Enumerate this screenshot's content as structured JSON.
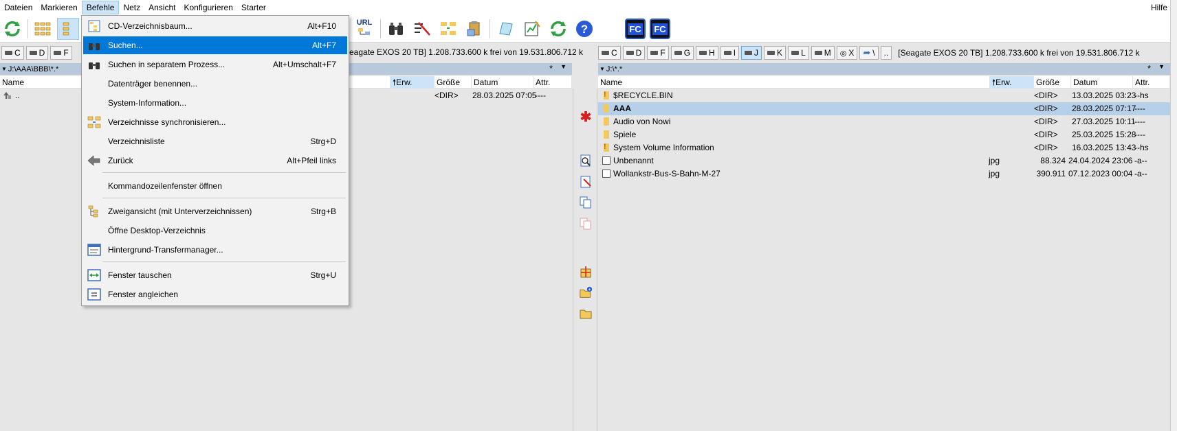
{
  "menubar": {
    "items": [
      "Dateien",
      "Markieren",
      "Befehle",
      "Netz",
      "Ansicht",
      "Konfigurieren",
      "Starter"
    ],
    "help": "Hilfe"
  },
  "toolbar": {
    "icons": [
      "refresh-icon",
      "brief-view-icon",
      "detailed-view-icon",
      "url-ftp-icon",
      "binoculars-icon",
      "multi-rename-icon",
      "sync-dirs-icon",
      "clipboard-icon",
      "notepad-icon",
      "compare-icon",
      "reload-icon",
      "help-icon",
      "fc-icon",
      "fc-icon"
    ],
    "url_label": "URL",
    "fc_label": "FC"
  },
  "left": {
    "drives": [
      "C",
      "D",
      "F"
    ],
    "drive_info_partial": "eagate EXOS 20 TB]  1.208.733.600 k frei von 19.531.806.712 k",
    "path": "J:\\AAA\\BBB\\*.*",
    "star": "*",
    "columns": {
      "name": "Name",
      "ext": "Erw.",
      "size": "Größe",
      "date": "Datum",
      "attr": "Attr."
    },
    "rows": [
      {
        "name": "..",
        "ext": "",
        "size": "<DIR>",
        "date": "28.03.2025 07:05",
        "attr": "----"
      }
    ]
  },
  "right": {
    "drives": [
      "C",
      "D",
      "F",
      "G",
      "H",
      "I",
      "J",
      "K",
      "L",
      "M",
      "X",
      "\\",
      ".."
    ],
    "selected_drive": "J",
    "drive_info": "[Seagate EXOS 20 TB]  1.208.733.600 k frei von 19.531.806.712 k",
    "path": "J:\\*.*",
    "star": "*",
    "columns": {
      "name": "Name",
      "ext": "Erw.",
      "size": "Größe",
      "date": "Datum",
      "attr": "Attr."
    },
    "rows": [
      {
        "name": "$RECYCLE.BIN",
        "ext": "",
        "size": "<DIR>",
        "date": "13.03.2025 03:23",
        "attr": "--hs",
        "type": "sysfolder"
      },
      {
        "name": "AAA",
        "ext": "",
        "size": "<DIR>",
        "date": "28.03.2025 07:17",
        "attr": "----",
        "type": "folder",
        "selected": true
      },
      {
        "name": "Audio von Nowi",
        "ext": "",
        "size": "<DIR>",
        "date": "27.03.2025 10:11",
        "attr": "----",
        "type": "folder"
      },
      {
        "name": "Spiele",
        "ext": "",
        "size": "<DIR>",
        "date": "25.03.2025 15:28",
        "attr": "----",
        "type": "folder"
      },
      {
        "name": "System Volume Information",
        "ext": "",
        "size": "<DIR>",
        "date": "16.03.2025 13:43",
        "attr": "--hs",
        "type": "sysfolder"
      },
      {
        "name": "Unbenannt",
        "ext": "jpg",
        "size": "88.324",
        "date": "24.04.2024 23:06",
        "attr": "-a--",
        "type": "img"
      },
      {
        "name": "Wollankstr-Bus-S-Bahn-M-27",
        "ext": "jpg",
        "size": "390.911",
        "date": "07.12.2023 00:04",
        "attr": "-a--",
        "type": "img"
      }
    ]
  },
  "befehle_menu": {
    "items": [
      {
        "label": "CD-Verzeichnisbaum...",
        "shortcut": "Alt+F10",
        "icon": "tree-icon"
      },
      {
        "label": "Suchen...",
        "shortcut": "Alt+F7",
        "icon": "binoculars-icon",
        "highlighted": true
      },
      {
        "label": "Suchen in separatem Prozess...",
        "shortcut": "Alt+Umschalt+F7",
        "icon": "binoculars-icon"
      },
      {
        "label": "Datenträger benennen...",
        "shortcut": "",
        "icon": ""
      },
      {
        "label": "System-Information...",
        "shortcut": "",
        "icon": ""
      },
      {
        "label": "Verzeichnisse synchronisieren...",
        "shortcut": "",
        "icon": "sync-dirs-icon"
      },
      {
        "label": "Verzeichnisliste",
        "shortcut": "Strg+D",
        "icon": ""
      },
      {
        "label": "Zurück",
        "shortcut": "Alt+Pfeil links",
        "icon": "back-arrow-icon"
      },
      {
        "label": "Kommandozeilenfenster öffnen",
        "shortcut": "",
        "icon": ""
      },
      {
        "label": "Zweigansicht (mit Unterverzeichnissen)",
        "shortcut": "Strg+B",
        "icon": "branch-view-icon"
      },
      {
        "label": "Öffne Desktop-Verzeichnis",
        "shortcut": "",
        "icon": ""
      },
      {
        "label": "Hintergrund-Transfermanager...",
        "shortcut": "",
        "icon": "transfer-manager-icon"
      },
      {
        "label": "Fenster tauschen",
        "shortcut": "Strg+U",
        "icon": "swap-windows-icon"
      },
      {
        "label": "Fenster angleichen",
        "shortcut": "",
        "icon": "equal-windows-icon"
      }
    ]
  },
  "colors": {
    "highlight": "#0078d7",
    "selection": "#b7d0ea",
    "pathbar": "#b9c9dc",
    "menu_active": "#cce4f7"
  }
}
